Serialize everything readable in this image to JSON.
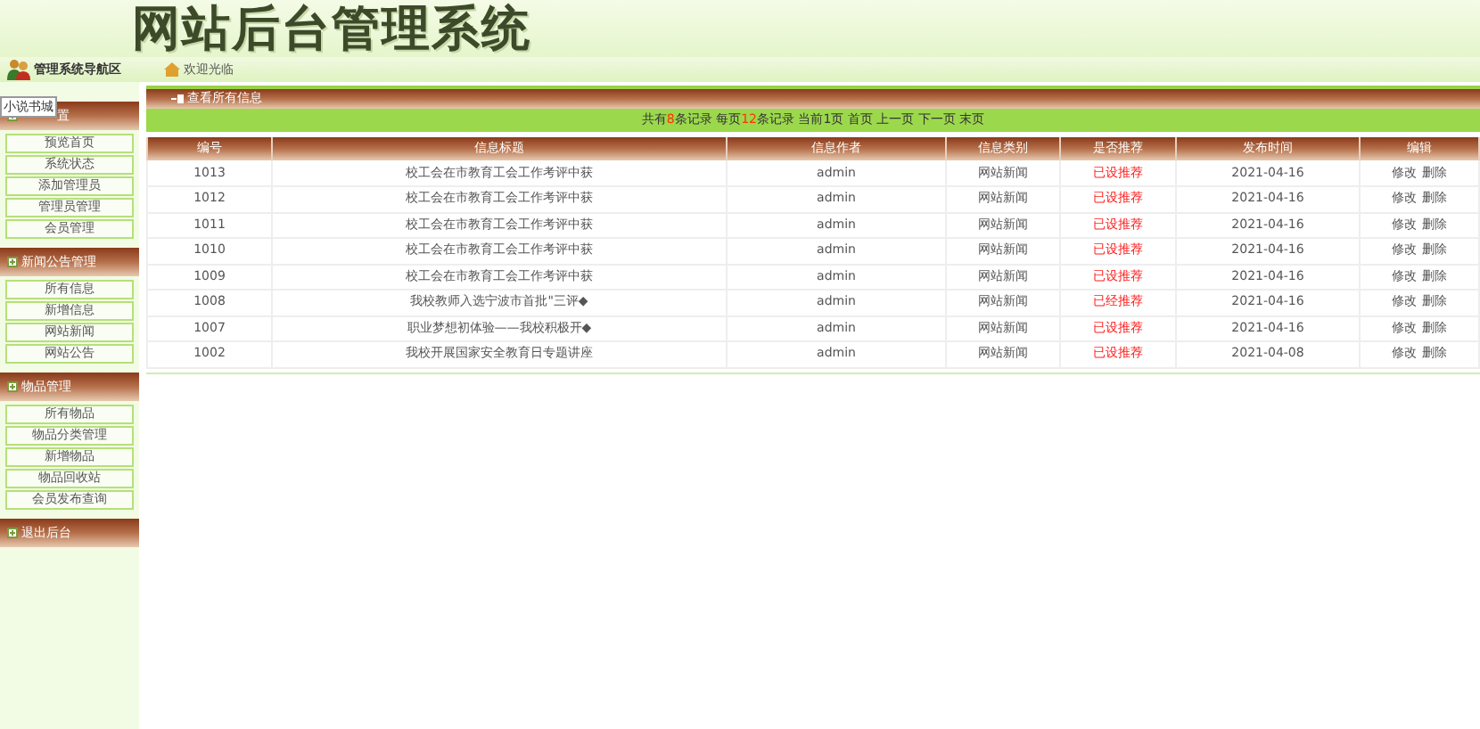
{
  "header": {
    "title": "网站后台管理系统"
  },
  "nav": {
    "title": "管理系统导航区",
    "welcome": "欢迎光临"
  },
  "sidebar": {
    "tooltip": "小说书城",
    "sections": [
      {
        "title": "置",
        "items": [
          "预览首页",
          "系统状态",
          "添加管理员",
          "管理员管理",
          "会员管理"
        ]
      },
      {
        "title": "新闻公告管理",
        "items": [
          "所有信息",
          "新增信息",
          "网站新闻",
          "网站公告"
        ]
      },
      {
        "title": "物品管理",
        "items": [
          "所有物品",
          "物品分类管理",
          "新增物品",
          "物品回收站",
          "会员发布查询"
        ]
      },
      {
        "title": "退出后台"
      }
    ]
  },
  "panel": {
    "title": "查看所有信息"
  },
  "pagination": [
    {
      "text": "共有",
      "kind": "plain"
    },
    {
      "text": "8",
      "kind": "count"
    },
    {
      "text": "条记录 每页",
      "kind": "plain"
    },
    {
      "text": "12",
      "kind": "count"
    },
    {
      "text": "条记录 当前1页 首页 上一页 下一页 末页",
      "kind": "plain"
    }
  ],
  "table": {
    "columns": [
      "编号",
      "信息标题",
      "信息作者",
      "信息类别",
      "是否推荐",
      "发布时间",
      "编辑"
    ],
    "rows": [
      {
        "id": "1013",
        "title": "校工会在市教育工会工作考评中获",
        "author": "admin",
        "category": "网站新闻",
        "recommend": "已设推荐",
        "date": "2021-04-16",
        "edit": "修改",
        "delete": "删除"
      },
      {
        "id": "1012",
        "title": "校工会在市教育工会工作考评中获",
        "author": "admin",
        "category": "网站新闻",
        "recommend": "已设推荐",
        "date": "2021-04-16",
        "edit": "修改",
        "delete": "删除"
      },
      {
        "id": "1011",
        "title": "校工会在市教育工会工作考评中获",
        "author": "admin",
        "category": "网站新闻",
        "recommend": "已设推荐",
        "date": "2021-04-16",
        "edit": "修改",
        "delete": "删除"
      },
      {
        "id": "1010",
        "title": "校工会在市教育工会工作考评中获",
        "author": "admin",
        "category": "网站新闻",
        "recommend": "已设推荐",
        "date": "2021-04-16",
        "edit": "修改",
        "delete": "删除"
      },
      {
        "id": "1009",
        "title": "校工会在市教育工会工作考评中获",
        "author": "admin",
        "category": "网站新闻",
        "recommend": "已设推荐",
        "date": "2021-04-16",
        "edit": "修改",
        "delete": "删除"
      },
      {
        "id": "1008",
        "title": "我校教师入选宁波市首批\"三评◆",
        "author": "admin",
        "category": "网站新闻",
        "recommend": "已经推荐",
        "date": "2021-04-16",
        "edit": "修改",
        "delete": "删除"
      },
      {
        "id": "1007",
        "title": "职业梦想初体验——我校积极开◆",
        "author": "admin",
        "category": "网站新闻",
        "recommend": "已设推荐",
        "date": "2021-04-16",
        "edit": "修改",
        "delete": "删除"
      },
      {
        "id": "1002",
        "title": "我校开展国家安全教育日专题讲座",
        "author": "admin",
        "category": "网站新闻",
        "recommend": "已设推荐",
        "date": "2021-04-08",
        "edit": "修改",
        "delete": "删除"
      }
    ]
  }
}
